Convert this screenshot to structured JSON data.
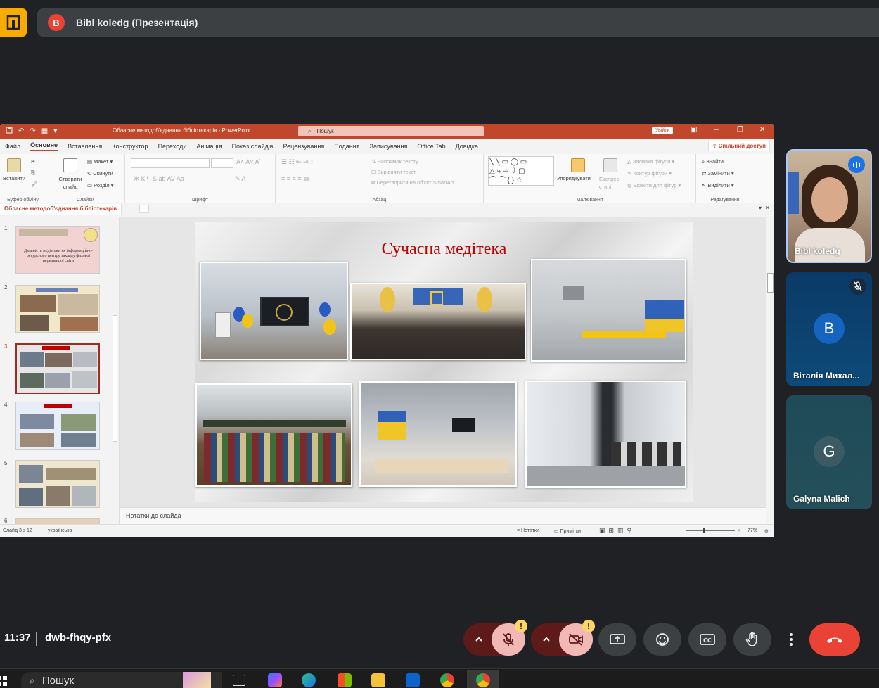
{
  "meet": {
    "title": "Bibl koledg (Презентація)",
    "title_avatar_letter": "B",
    "time": "11:37",
    "meeting_code": "dwb-fhqy-pfx"
  },
  "ppt": {
    "document_title": "Обласне методоб'єднання бібліотекарів - PowerPoint",
    "search_placeholder": "Пошук",
    "sign_in": "Увійти",
    "menu": [
      "Файл",
      "Основне",
      "Вставлення",
      "Конструктор",
      "Переходи",
      "Анімація",
      "Показ слайдів",
      "Рецензування",
      "Подання",
      "Записування",
      "Office Tab",
      "Довідка"
    ],
    "active_menu": "Основне",
    "share": "Спільний доступ",
    "ribbon": {
      "paste": "Вставити",
      "clipboard": "Буфер обміну",
      "new_slide": "Створити слайд",
      "layout": "Макет",
      "reset": "Скинути",
      "section": "Розділ",
      "slides": "Слайди",
      "font": "Шрифт",
      "text_direction": "Напрямок тексту",
      "align_text": "Вирівняти текст",
      "smartart": "Перетворити на об'єкт SmartArt",
      "paragraph": "Абзац",
      "arrange": "Упорядкувати",
      "quick_styles": "Експрес-стилі",
      "shape_fill": "Заливка фігури",
      "shape_outline": "Контур фігури",
      "shape_effects": "Ефекти для фігур",
      "drawing": "Малювання",
      "find": "Знайти",
      "replace": "Замінити",
      "select": "Виділити",
      "editing": "Редагування"
    },
    "doc_tab": "Обласне методоб'єднання бібліотекарів",
    "slide_numbers": [
      "1",
      "2",
      "3",
      "4",
      "5",
      "6"
    ],
    "thumb1_title": "Дяльність медіатеки як інформаційно-ресурсного центру закладу фахової передвищої світи",
    "slide_title": "Сучасна медітека",
    "notes_placeholder": "Нотатки до слайда",
    "status": {
      "slide_counter": "Слайд 3 з 12",
      "language": "українська",
      "notes": "Нотатки",
      "comments": "Примітки",
      "zoom": "77%"
    }
  },
  "participants": [
    {
      "name": "Bibl koledg",
      "avatar": ""
    },
    {
      "name": "Віталія Михал...",
      "avatar": "B"
    },
    {
      "name": "Galyna Malich",
      "avatar": "G"
    }
  ],
  "taskbar": {
    "search": "Пошук"
  },
  "colors": {
    "ppt_accent": "#c0462c",
    "meet_bg": "#202124",
    "hangup": "#ea4335",
    "slide_title": "#c00000"
  }
}
